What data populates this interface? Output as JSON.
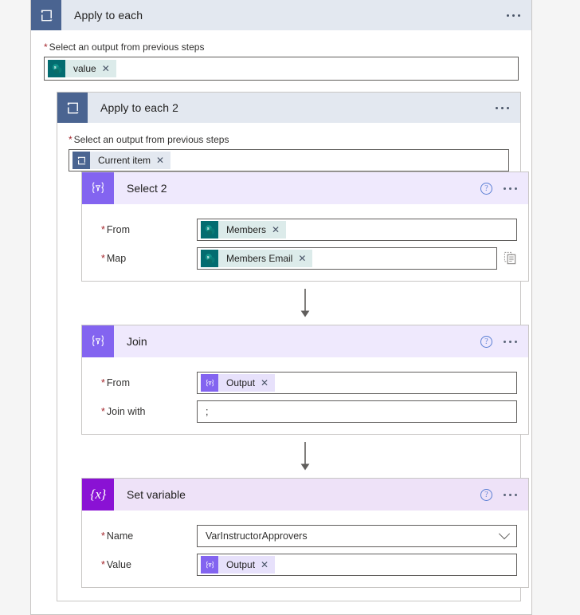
{
  "outer_scope": {
    "title": "Apply to each",
    "icon": "loop-icon",
    "field_label": "Select an output from previous steps",
    "token": {
      "label": "value",
      "icon": "sharepoint-icon",
      "remove": "✕"
    },
    "menu": "more-options"
  },
  "inner_scope": {
    "title": "Apply to each 2",
    "icon": "loop-icon",
    "field_label": "Select an output from previous steps",
    "token": {
      "label": "Current item",
      "icon": "loop-icon",
      "remove": "✕"
    },
    "menu": "more-options"
  },
  "actions": [
    {
      "title": "Select 2",
      "icon_glyph": "{▽}",
      "icon_name": "data-operation-icon",
      "help": "?",
      "menu": "more-options",
      "fields": [
        {
          "label": "From",
          "required": true,
          "type": "token",
          "token": {
            "label": "Members",
            "icon": "sharepoint-icon",
            "remove": "✕"
          }
        },
        {
          "label": "Map",
          "required": true,
          "type": "token",
          "token": {
            "label": "Members Email",
            "icon": "sharepoint-icon",
            "remove": "✕"
          },
          "trailing_icon": "copy-icon"
        }
      ]
    },
    {
      "title": "Join",
      "icon_glyph": "{▽}",
      "icon_name": "data-operation-icon",
      "help": "?",
      "menu": "more-options",
      "fields": [
        {
          "label": "From",
          "required": true,
          "type": "token",
          "token": {
            "label": "Output",
            "icon": "data-operation-icon",
            "remove": "✕"
          }
        },
        {
          "label": "Join with",
          "required": true,
          "type": "text",
          "value": ";"
        }
      ]
    },
    {
      "title": "Set variable",
      "icon_glyph": "{x}",
      "icon_name": "variable-icon",
      "help": "?",
      "menu": "more-options",
      "fields": [
        {
          "label": "Name",
          "required": true,
          "type": "dropdown",
          "value": "VarInstructorApprovers"
        },
        {
          "label": "Value",
          "required": true,
          "type": "token",
          "token": {
            "label": "Output",
            "icon": "data-operation-icon",
            "remove": "✕"
          }
        }
      ]
    }
  ],
  "colors": {
    "scope_header_bg": "#e3e8f0",
    "scope_icon_bg": "#4a6491",
    "dataop_purple": "#8364f0",
    "variable_purple": "#8a12d4",
    "sharepoint_teal": "#036c70",
    "required_red": "#a4262c",
    "help_blue": "#5b7fd4",
    "page_bg": "#f5f5f5"
  }
}
